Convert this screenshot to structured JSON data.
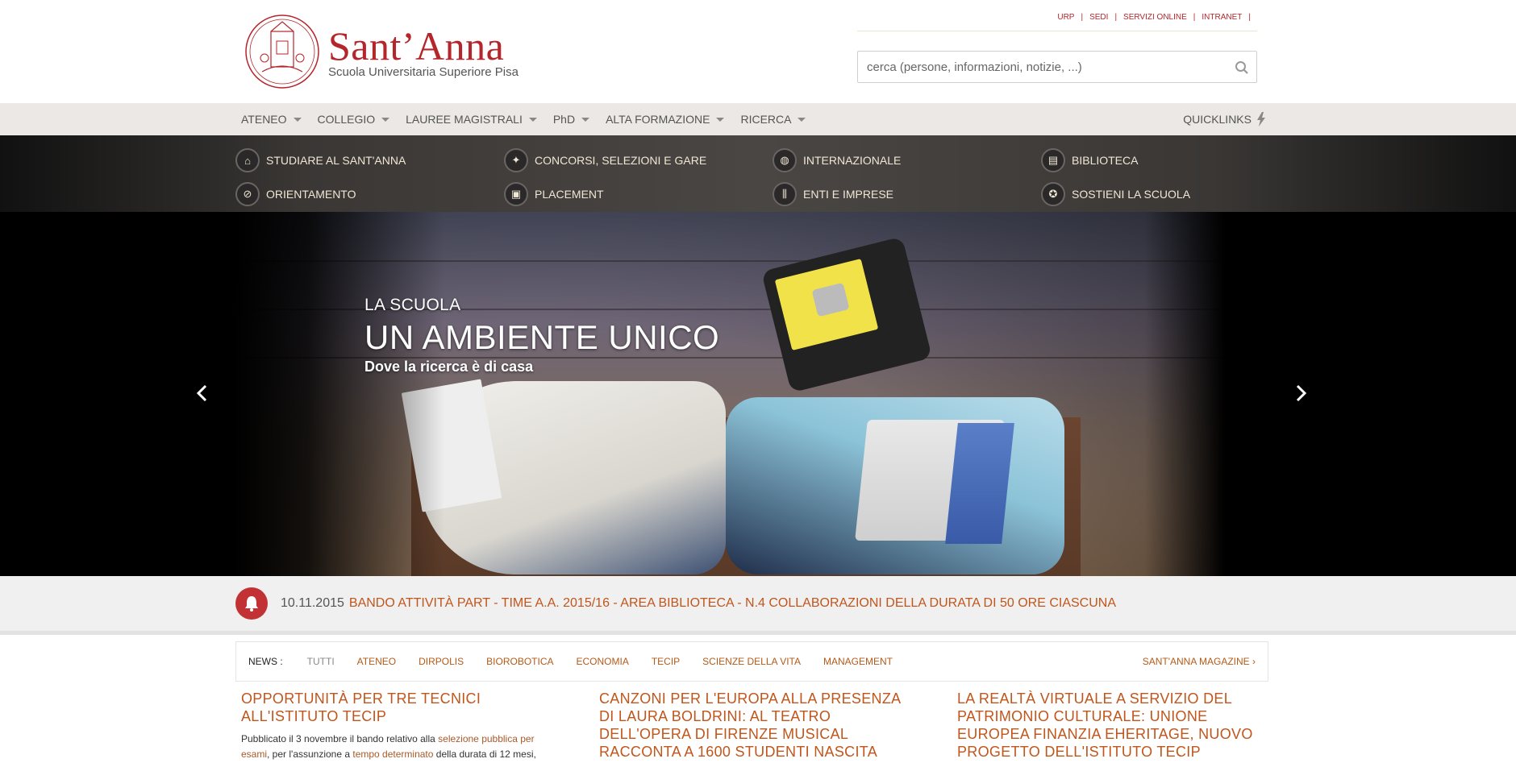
{
  "header": {
    "logo_name": "Sant’Anna",
    "logo_sub": "Scuola Universitaria Superiore Pisa",
    "toplinks": [
      "URP",
      "SEDI",
      "SERVIZI ONLINE",
      "INTRANET"
    ],
    "search_placeholder": "cerca (persone, informazioni, notizie, ...)"
  },
  "mainnav": {
    "items": [
      "ATENEO",
      "COLLEGIO",
      "LAUREE MAGISTRALI",
      "PhD",
      "ALTA FORMAZIONE",
      "RICERCA"
    ],
    "quicklinks": "QUICKLINKS"
  },
  "quicknav": {
    "items": [
      {
        "label": "STUDIARE AL SANT'ANNA",
        "icon": "building-icon"
      },
      {
        "label": "CONCORSI, SELEZIONI E GARE",
        "icon": "pin-icon"
      },
      {
        "label": "INTERNAZIONALE",
        "icon": "globe-icon"
      },
      {
        "label": "BIBLIOTECA",
        "icon": "book-icon"
      },
      {
        "label": "ORIENTAMENTO",
        "icon": "compass-icon"
      },
      {
        "label": "PLACEMENT",
        "icon": "briefcase-icon"
      },
      {
        "label": "ENTI E IMPRESE",
        "icon": "institution-icon"
      },
      {
        "label": "SOSTIENI LA SCUOLA",
        "icon": "award-icon"
      }
    ]
  },
  "hero": {
    "kicker": "LA SCUOLA",
    "title": "UN AMBIENTE UNICO",
    "subtitle": "Dove la ricerca è di casa"
  },
  "ticker": {
    "date": "10.11.2015",
    "text": "BANDO ATTIVITÀ PART - TIME  A.A. 2015/16 - AREA BIBLIOTECA - N.4 COLLABORAZIONI DELLA DURATA DI 50 ORE CIASCUNA"
  },
  "news": {
    "label": "NEWS :",
    "tabs": [
      "TUTTI",
      "ATENEO",
      "DIRPOLIS",
      "BIOROBOTICA",
      "ECONOMIA",
      "TECIP",
      "SCIENZE DELLA VITA",
      "MANAGEMENT"
    ],
    "magazine": "SANT'ANNA MAGAZINE ›",
    "articles": [
      {
        "title": "OPPORTUNITÀ PER TRE TECNICI ALL'ISTITUTO TECIP",
        "p1": "Pubblicato il 3 novembre il bando relativo alla ",
        "l1": "selezione pubblica per esami",
        "p2": ", per l'assunzione a ",
        "l2": "tempo determinato",
        "p3": " della durata di 12 mesi,"
      },
      {
        "title": "CANZONI PER L'EUROPA ALLA PRESENZA DI LAURA BOLDRINI: AL TEATRO DELL'OPERA DI FIRENZE MUSICAL RACCONTA A 1600 STUDENTI NASCITA DELL'UNIONE E LANCIA TRE GIORNI DI"
      },
      {
        "title": "LA REALTÀ VIRTUALE A SERVIZIO DEL PATRIMONIO CULTURALE: UNIONE EUROPEA FINANZIA EHERITAGE, NUOVO PROGETTO DELL'ISTITUTO TECIP"
      }
    ]
  },
  "colors": {
    "brand": "#b5262b",
    "accent": "#c0561c",
    "nav_bg": "#ebe8e5",
    "dark_nav": "#3a3735"
  }
}
